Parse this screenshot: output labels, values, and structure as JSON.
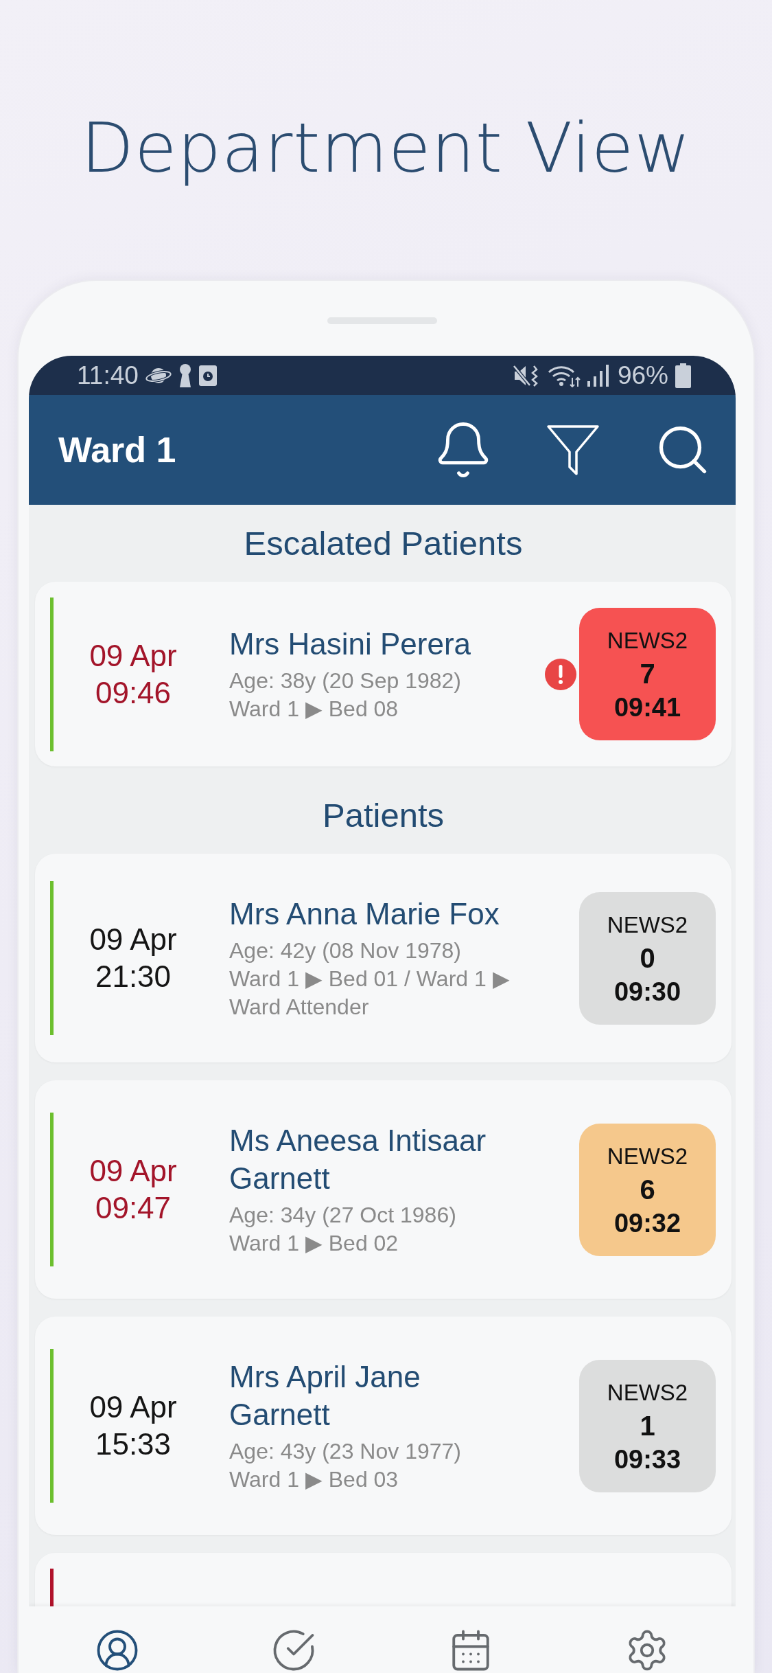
{
  "page_title": "Department View",
  "status_bar": {
    "time": "11:40",
    "battery": "96%"
  },
  "header": {
    "title": "Ward 1"
  },
  "sections": [
    {
      "heading": "Escalated Patients",
      "patients": [
        {
          "date": "09 Apr",
          "time": "09:46",
          "overdue": true,
          "name": "Mrs Hasini Perera",
          "age": "Age: 38y (20 Sep 1982)",
          "location": "Ward 1 ▶ Bed 08",
          "alert": true,
          "stripe": {
            "color": "#6cbf2e"
          },
          "news2": {
            "label": "NEWS2",
            "score": "7",
            "time": "09:41",
            "color": "#f65252"
          }
        }
      ]
    },
    {
      "heading": "Patients",
      "patients": [
        {
          "date": "09 Apr",
          "time": "21:30",
          "overdue": false,
          "name": "Mrs Anna Marie Fox",
          "age": "Age: 42y (08 Nov 1978)",
          "location": "Ward 1 ▶ Bed 01 / Ward 1 ▶ Ward Attender",
          "alert": false,
          "stripe": {
            "color": "#6cbf2e"
          },
          "news2": {
            "label": "NEWS2",
            "score": "0",
            "time": "09:30",
            "color": "#dcdddd"
          }
        },
        {
          "date": "09 Apr",
          "time": "09:47",
          "overdue": true,
          "name": "Ms Aneesa Intisaar Garnett",
          "age": "Age: 34y (27 Oct 1986)",
          "location": "Ward 1 ▶ Bed 02",
          "alert": false,
          "stripe": {
            "color": "#6cbf2e"
          },
          "news2": {
            "label": "NEWS2",
            "score": "6",
            "time": "09:32",
            "color": "#f5c88c"
          }
        },
        {
          "date": "09 Apr",
          "time": "15:33",
          "overdue": false,
          "name": "Mrs April Jane Garnett",
          "age": "Age: 43y (23 Nov 1977)",
          "location": "Ward 1 ▶ Bed 03",
          "alert": false,
          "stripe": {
            "color": "#6cbf2e"
          },
          "news2": {
            "label": "NEWS2",
            "score": "1",
            "time": "09:33",
            "color": "#dcdddd"
          }
        },
        {
          "stripe": {
            "color": "#b0122b"
          }
        }
      ]
    }
  ],
  "bottom_nav": [
    {
      "selected": true
    },
    {
      "selected": false
    },
    {
      "selected": false
    },
    {
      "selected": false
    }
  ]
}
